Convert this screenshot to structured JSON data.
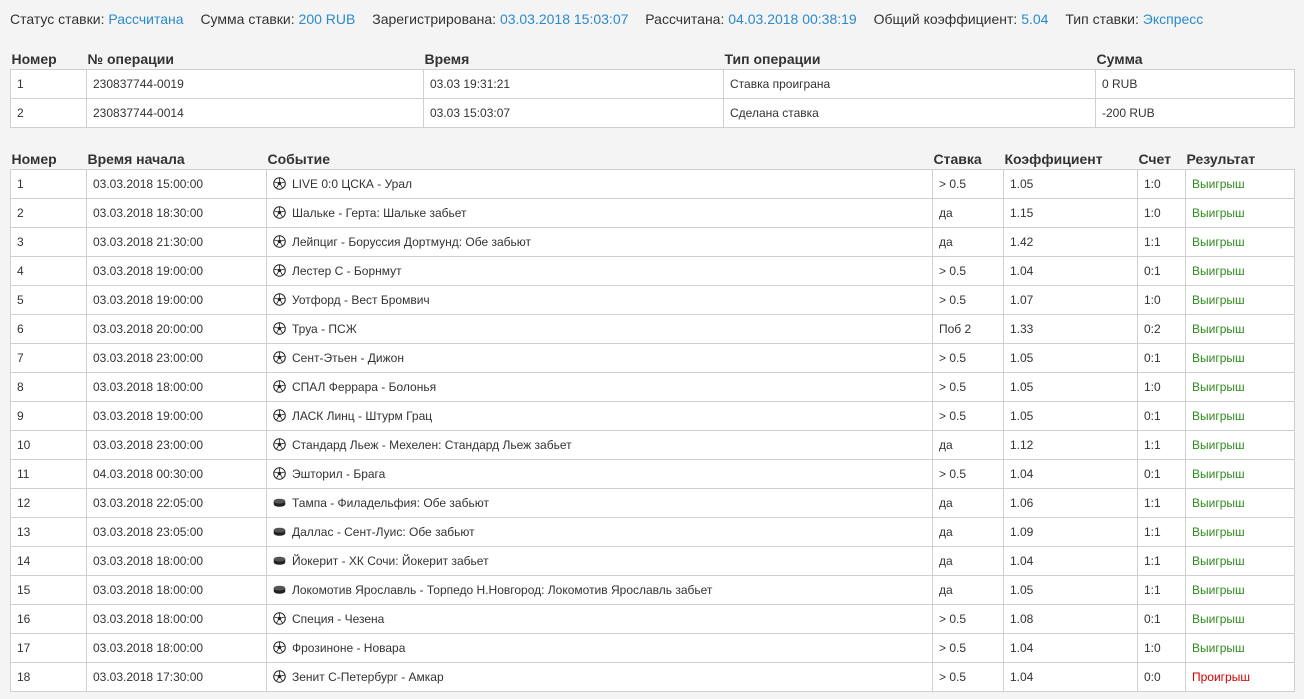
{
  "summary": {
    "status_label": "Статус ставки:",
    "status_value": "Рассчитана",
    "amount_label": "Сумма ставки:",
    "amount_value": "200 RUB",
    "registered_label": "Зарегистрирована:",
    "registered_value": "03.03.2018 15:03:07",
    "settled_label": "Рассчитана:",
    "settled_value": "04.03.2018 00:38:19",
    "coef_label": "Общий коэффициент:",
    "coef_value": "5.04",
    "type_label": "Тип ставки:",
    "type_value": "Экспресс"
  },
  "operations": {
    "headers": [
      "Номер",
      "№ операции",
      "Время",
      "Тип операции",
      "Сумма"
    ],
    "rows": [
      [
        "1",
        "230837744-0019",
        "03.03 19:31:21",
        "Ставка проиграна",
        "0 RUB"
      ],
      [
        "2",
        "230837744-0014",
        "03.03 15:03:07",
        "Сделана ставка",
        "-200 RUB"
      ]
    ]
  },
  "events": {
    "headers": [
      "Номер",
      "Время начала",
      "Событие",
      "Ставка",
      "Коэффициент",
      "Счет",
      "Результат"
    ],
    "rows": [
      {
        "num": "1",
        "time": "03.03.2018 15:00:00",
        "sport": "soccer-ball-icon",
        "event": "LIVE 0:0 ЦСКА - Урал",
        "bet": "> 0.5",
        "coef": "1.05",
        "score": "1:0",
        "result": "Выигрыш",
        "status": "win"
      },
      {
        "num": "2",
        "time": "03.03.2018 18:30:00",
        "sport": "soccer-ball-icon",
        "event": "Шальке - Герта: Шальке забьет",
        "bet": "да",
        "coef": "1.15",
        "score": "1:0",
        "result": "Выигрыш",
        "status": "win"
      },
      {
        "num": "3",
        "time": "03.03.2018 21:30:00",
        "sport": "soccer-ball-icon",
        "event": "Лейпциг - Боруссия Дортмунд: Обе забьют",
        "bet": "да",
        "coef": "1.42",
        "score": "1:1",
        "result": "Выигрыш",
        "status": "win"
      },
      {
        "num": "4",
        "time": "03.03.2018 19:00:00",
        "sport": "soccer-ball-icon",
        "event": "Лестер С - Борнмут",
        "bet": "> 0.5",
        "coef": "1.04",
        "score": "0:1",
        "result": "Выигрыш",
        "status": "win"
      },
      {
        "num": "5",
        "time": "03.03.2018 19:00:00",
        "sport": "soccer-ball-icon",
        "event": "Уотфорд - Вест Бромвич",
        "bet": "> 0.5",
        "coef": "1.07",
        "score": "1:0",
        "result": "Выигрыш",
        "status": "win"
      },
      {
        "num": "6",
        "time": "03.03.2018 20:00:00",
        "sport": "soccer-ball-icon",
        "event": "Труа - ПСЖ",
        "bet": "Поб 2",
        "coef": "1.33",
        "score": "0:2",
        "result": "Выигрыш",
        "status": "win"
      },
      {
        "num": "7",
        "time": "03.03.2018 23:00:00",
        "sport": "soccer-ball-icon",
        "event": "Сент-Этьен - Дижон",
        "bet": "> 0.5",
        "coef": "1.05",
        "score": "0:1",
        "result": "Выигрыш",
        "status": "win"
      },
      {
        "num": "8",
        "time": "03.03.2018 18:00:00",
        "sport": "soccer-ball-icon",
        "event": "СПАЛ Феррара - Болонья",
        "bet": "> 0.5",
        "coef": "1.05",
        "score": "1:0",
        "result": "Выигрыш",
        "status": "win"
      },
      {
        "num": "9",
        "time": "03.03.2018 19:00:00",
        "sport": "soccer-ball-icon",
        "event": "ЛАСК Линц - Штурм Грац",
        "bet": "> 0.5",
        "coef": "1.05",
        "score": "0:1",
        "result": "Выигрыш",
        "status": "win"
      },
      {
        "num": "10",
        "time": "03.03.2018 23:00:00",
        "sport": "soccer-ball-icon",
        "event": "Стандард Льеж - Мехелен: Стандард Льеж забьет",
        "bet": "да",
        "coef": "1.12",
        "score": "1:1",
        "result": "Выигрыш",
        "status": "win"
      },
      {
        "num": "11",
        "time": "04.03.2018 00:30:00",
        "sport": "soccer-ball-icon",
        "event": "Эшторил - Брага",
        "bet": "> 0.5",
        "coef": "1.04",
        "score": "0:1",
        "result": "Выигрыш",
        "status": "win"
      },
      {
        "num": "12",
        "time": "03.03.2018 22:05:00",
        "sport": "hockey-puck-icon",
        "event": "Тампа - Филадельфия: Обе забьют",
        "bet": "да",
        "coef": "1.06",
        "score": "1:1",
        "result": "Выигрыш",
        "status": "win"
      },
      {
        "num": "13",
        "time": "03.03.2018 23:05:00",
        "sport": "hockey-puck-icon",
        "event": "Даллас - Сент-Луис: Обе забьют",
        "bet": "да",
        "coef": "1.09",
        "score": "1:1",
        "result": "Выигрыш",
        "status": "win"
      },
      {
        "num": "14",
        "time": "03.03.2018 18:00:00",
        "sport": "hockey-puck-icon",
        "event": "Йокерит - ХК Сочи: Йокерит забьет",
        "bet": "да",
        "coef": "1.04",
        "score": "1:1",
        "result": "Выигрыш",
        "status": "win"
      },
      {
        "num": "15",
        "time": "03.03.2018 18:00:00",
        "sport": "hockey-puck-icon",
        "event": "Локомотив Ярославль - Торпедо Н.Новгород: Локомотив Ярославль забьет",
        "bet": "да",
        "coef": "1.05",
        "score": "1:1",
        "result": "Выигрыш",
        "status": "win"
      },
      {
        "num": "16",
        "time": "03.03.2018 18:00:00",
        "sport": "soccer-ball-icon",
        "event": "Специя - Чезена",
        "bet": "> 0.5",
        "coef": "1.08",
        "score": "0:1",
        "result": "Выигрыш",
        "status": "win"
      },
      {
        "num": "17",
        "time": "03.03.2018 18:00:00",
        "sport": "soccer-ball-icon",
        "event": "Фрозиноне - Новара",
        "bet": "> 0.5",
        "coef": "1.04",
        "score": "1:0",
        "result": "Выигрыш",
        "status": "win"
      },
      {
        "num": "18",
        "time": "03.03.2018 17:30:00",
        "sport": "soccer-ball-icon",
        "event": "Зенит С-Петербург - Амкар",
        "bet": "> 0.5",
        "coef": "1.04",
        "score": "0:0",
        "result": "Проигрыш",
        "status": "lose"
      }
    ]
  },
  "colors": {
    "link": "#2b8acd",
    "win": "#2e8b1e",
    "lose": "#d40000",
    "border": "#cfcfcf",
    "page": "#f4f4f4"
  }
}
